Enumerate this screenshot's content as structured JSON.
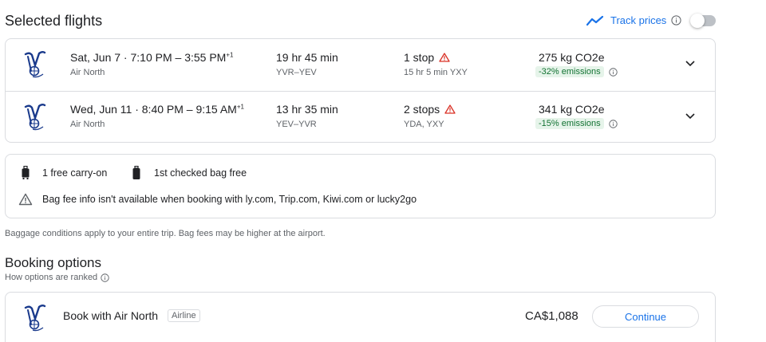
{
  "header": {
    "title": "Selected flights",
    "track_label": "Track prices"
  },
  "flights": [
    {
      "date": "Sat, Jun 7",
      "times": "7:10 PM – 3:55 PM",
      "day_offset": "+1",
      "airline": "Air North",
      "duration": "19 hr 45 min",
      "route": "YVR–YEV",
      "stops": "1 stop",
      "layover": "15 hr 5 min YXY",
      "co2": "275 kg CO2e",
      "emissions": "-32% emissions"
    },
    {
      "date": "Wed, Jun 11",
      "times": "8:40 PM – 9:15 AM",
      "day_offset": "+1",
      "airline": "Air North",
      "duration": "13 hr 35 min",
      "route": "YEV–YVR",
      "stops": "2 stops",
      "layover": "YDA, YXY",
      "co2": "341 kg CO2e",
      "emissions": "-15% emissions"
    }
  ],
  "bags": {
    "carry_on": "1 free carry-on",
    "checked": "1st checked bag free",
    "warning": "Bag fee info isn't available when booking with ly.com, Trip.com, Kiwi.com or lucky2go"
  },
  "baggage_note": "Baggage conditions apply to your entire trip. Bag fees may be higher at the airport.",
  "booking": {
    "title": "Booking options",
    "ranked_label": "How options are ranked",
    "option": {
      "label": "Book with Air North",
      "badge": "Airline",
      "price": "CA$1,088",
      "button": "Continue"
    }
  },
  "colors": {
    "accent": "#1a73e8",
    "emissions_text": "#137333",
    "emissions_bg": "#e6f4ea",
    "warning": "#d93025",
    "logo": "#1a3a8c"
  }
}
